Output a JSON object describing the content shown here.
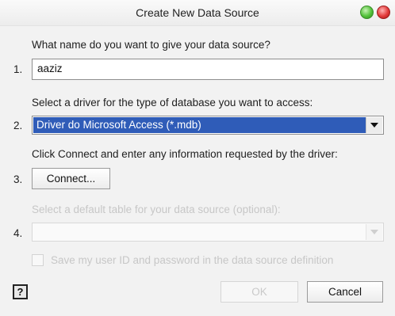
{
  "window": {
    "title": "Create New Data Source"
  },
  "steps": [
    {
      "number": "1.",
      "prompt": "What name do you want to give your data source?",
      "value": "aaziz"
    },
    {
      "number": "2.",
      "prompt": "Select a driver for the type of database you want to access:",
      "value": "Driver do Microsoft Access (*.mdb)"
    },
    {
      "number": "3.",
      "prompt": "Click Connect and enter any information requested by the driver:",
      "button_label": "Connect..."
    },
    {
      "number": "4.",
      "prompt": "Select a default table for your data source (optional):",
      "value": ""
    }
  ],
  "save_option": {
    "label": "Save my user ID and password in the data source definition",
    "checked": false
  },
  "footer": {
    "help_glyph": "?",
    "ok_label": "OK",
    "cancel_label": "Cancel"
  },
  "colors": {
    "selection": "#2f5cb8",
    "window_bg": "#f2f2f2",
    "disabled_text": "#c7c7c7"
  }
}
